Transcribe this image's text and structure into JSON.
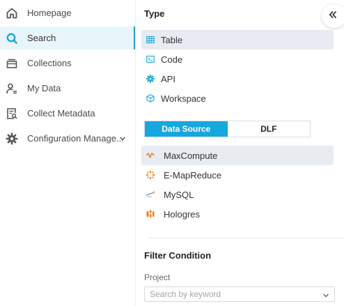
{
  "sidebar": {
    "items": [
      {
        "label": "Homepage",
        "icon": "home-icon"
      },
      {
        "label": "Search",
        "icon": "search-icon"
      },
      {
        "label": "Collections",
        "icon": "collections-icon"
      },
      {
        "label": "My Data",
        "icon": "user-data-icon"
      },
      {
        "label": "Collect Metadata",
        "icon": "metadata-icon"
      },
      {
        "label": "Configuration Manage...",
        "icon": "gear-icon"
      }
    ],
    "active_index": 1
  },
  "panel": {
    "type_title": "Type",
    "types": [
      {
        "label": "Table",
        "icon": "table-icon",
        "selected": true
      },
      {
        "label": "Code",
        "icon": "terminal-icon",
        "selected": false
      },
      {
        "label": "API",
        "icon": "api-icon",
        "selected": false
      },
      {
        "label": "Workspace",
        "icon": "workspace-icon",
        "selected": false
      }
    ],
    "source_tabs": [
      {
        "label": "Data Source",
        "active": true
      },
      {
        "label": "DLF",
        "active": false
      }
    ],
    "sources": [
      {
        "label": "MaxCompute",
        "icon": "maxcompute-icon",
        "selected": true
      },
      {
        "label": "E-MapReduce",
        "icon": "emapreduce-icon",
        "selected": false
      },
      {
        "label": "MySQL",
        "icon": "mysql-icon",
        "selected": false
      },
      {
        "label": "Hologres",
        "icon": "hologres-icon",
        "selected": false
      }
    ],
    "filter_title": "Filter Condition",
    "project_label": "Project",
    "project_placeholder": "Search by keyword"
  },
  "colors": {
    "accent": "#15a7de",
    "active_nav_bg": "#e8f5fa",
    "selected_bg": "#e9ebf2",
    "orange": "#f07d26"
  }
}
